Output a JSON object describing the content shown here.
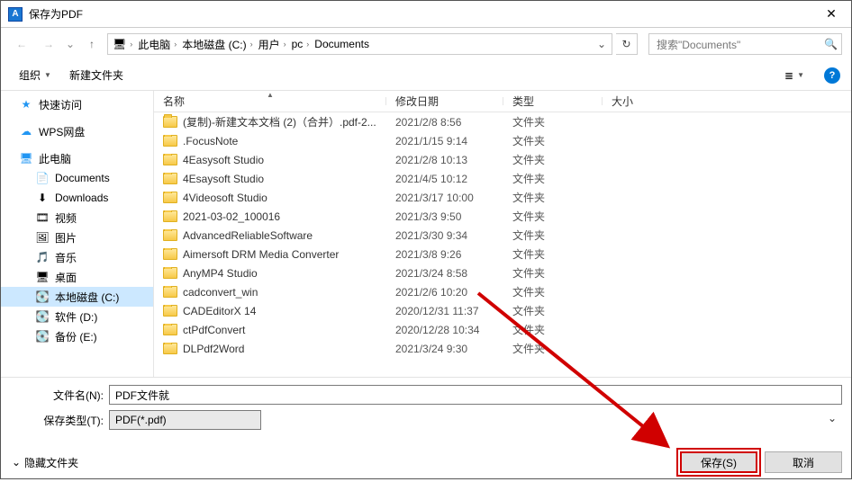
{
  "title": "保存为PDF",
  "nav": {
    "back": "←",
    "fwd": "→",
    "up": "↑",
    "refresh": "↻"
  },
  "breadcrumb": [
    "此电脑",
    "本地磁盘 (C:)",
    "用户",
    "pc",
    "Documents"
  ],
  "search": {
    "placeholder": "搜索\"Documents\""
  },
  "toolbar": {
    "organize": "组织",
    "newfolder": "新建文件夹",
    "viewopts": "≣"
  },
  "tree": {
    "quick": "快速访问",
    "wps": "WPS网盘",
    "thispc": "此电脑",
    "sub": [
      {
        "icon": "doc",
        "label": "Documents"
      },
      {
        "icon": "down",
        "label": "Downloads"
      },
      {
        "icon": "video",
        "label": "视频"
      },
      {
        "icon": "pic",
        "label": "图片"
      },
      {
        "icon": "music",
        "label": "音乐"
      },
      {
        "icon": "desk",
        "label": "桌面"
      },
      {
        "icon": "disk",
        "label": "本地磁盘 (C:)",
        "selected": true
      },
      {
        "icon": "disk",
        "label": "软件 (D:)"
      },
      {
        "icon": "disk",
        "label": "备份 (E:)"
      }
    ]
  },
  "columns": {
    "name": "名称",
    "date": "修改日期",
    "type": "类型",
    "size": "大小"
  },
  "folder_type": "文件夹",
  "files": [
    {
      "name": "(复制)-新建文本文档 (2)（合并）.pdf-2...",
      "date": "2021/2/8 8:56"
    },
    {
      "name": ".FocusNote",
      "date": "2021/1/15 9:14"
    },
    {
      "name": "4Easysoft Studio",
      "date": "2021/2/8 10:13"
    },
    {
      "name": "4Esaysoft Studio",
      "date": "2021/4/5 10:12"
    },
    {
      "name": "4Videosoft Studio",
      "date": "2021/3/17 10:00"
    },
    {
      "name": "2021-03-02_100016",
      "date": "2021/3/3 9:50"
    },
    {
      "name": "AdvancedReliableSoftware",
      "date": "2021/3/30 9:34"
    },
    {
      "name": "Aimersoft DRM Media Converter",
      "date": "2021/3/8 9:26"
    },
    {
      "name": "AnyMP4 Studio",
      "date": "2021/3/24 8:58"
    },
    {
      "name": "cadconvert_win",
      "date": "2021/2/6 10:20"
    },
    {
      "name": "CADEditorX 14",
      "date": "2020/12/31 11:37"
    },
    {
      "name": "ctPdfConvert",
      "date": "2020/12/28 10:34"
    },
    {
      "name": "DLPdf2Word",
      "date": "2021/3/24 9:30"
    }
  ],
  "form": {
    "filename_label": "文件名(N):",
    "filename_value": "PDF文件就",
    "type_label": "保存类型(T):",
    "type_value": "PDF(*.pdf)",
    "hide_folders": "隐藏文件夹",
    "save": "保存(S)",
    "cancel": "取消"
  }
}
